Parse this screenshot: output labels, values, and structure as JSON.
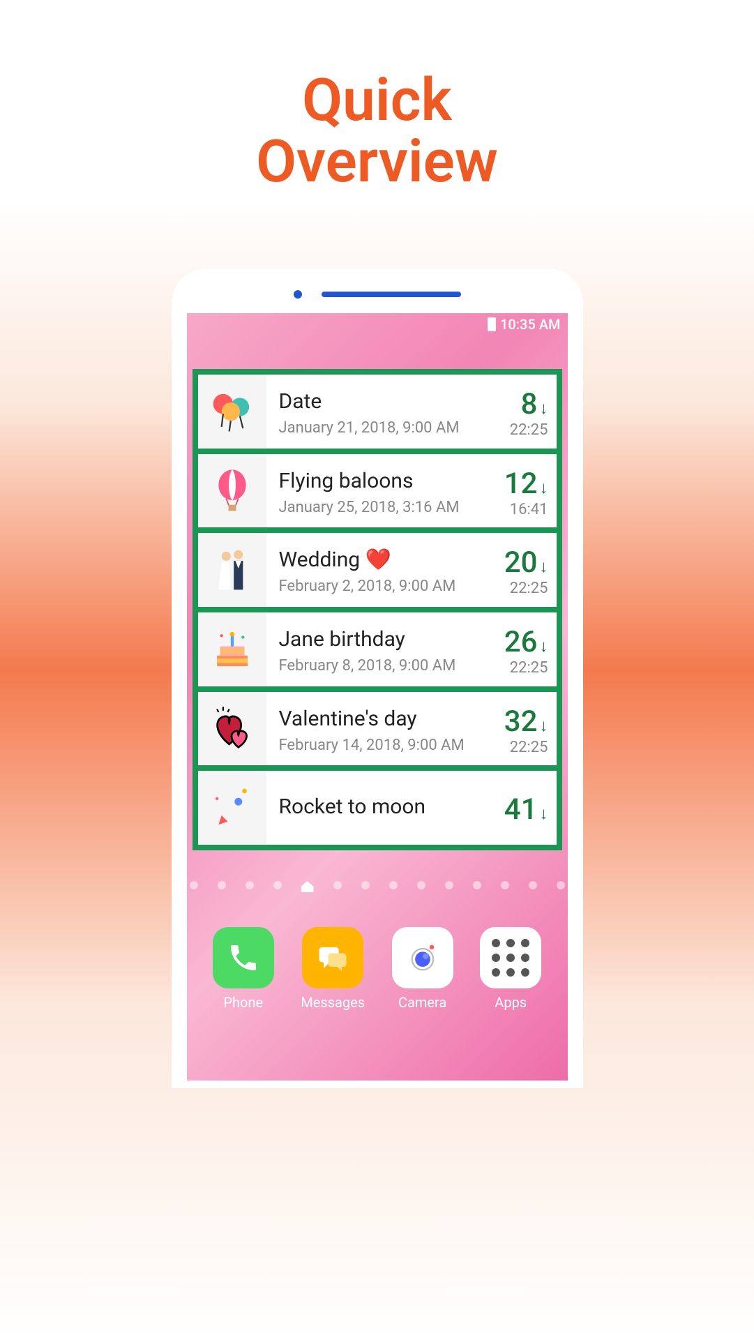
{
  "title_line1": "Quick",
  "title_line2": "Overview",
  "status": {
    "time": "10:35 AM"
  },
  "events": [
    {
      "icon": "balloons",
      "title": "Date",
      "date": "January 21, 2018, 9:00 AM",
      "days": "8",
      "time": "22:25"
    },
    {
      "icon": "hotair",
      "title": "Flying baloons",
      "date": "January 25, 2018, 3:16 AM",
      "days": "12",
      "time": "16:41"
    },
    {
      "icon": "wedding",
      "title": "Wedding ❤️",
      "date": "February 2, 2018, 9:00 AM",
      "days": "20",
      "time": "22:25"
    },
    {
      "icon": "cake",
      "title": "Jane birthday",
      "date": "February 8, 2018, 9:00 AM",
      "days": "26",
      "time": "22:25"
    },
    {
      "icon": "hearts",
      "title": "Valentine's day",
      "date": "February 14, 2018, 9:00 AM",
      "days": "32",
      "time": "22:25"
    },
    {
      "icon": "rocket",
      "title": "Rocket to moon",
      "date": "",
      "days": "41",
      "time": ""
    }
  ],
  "dock": [
    {
      "label": "Phone",
      "icon": "phone"
    },
    {
      "label": "Messages",
      "icon": "messages"
    },
    {
      "label": "Camera",
      "icon": "camera"
    },
    {
      "label": "Apps",
      "icon": "apps"
    }
  ]
}
